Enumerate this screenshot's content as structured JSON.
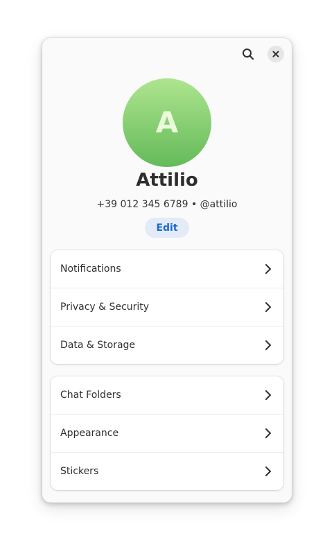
{
  "header": {
    "search_icon": "search-icon",
    "close_icon": "close-icon"
  },
  "profile": {
    "avatar_letter": "A",
    "name": "Attilio",
    "subtitle": "+39 012 345 6789 • @attilio",
    "edit_label": "Edit",
    "avatar_gradient": [
      "#aee58e",
      "#64ba5a"
    ],
    "accent": "#1c6ac8"
  },
  "groups": [
    {
      "items": [
        {
          "label": "Notifications",
          "icon": "chevron-right-icon"
        },
        {
          "label": "Privacy & Security",
          "icon": "chevron-right-icon"
        },
        {
          "label": "Data & Storage",
          "icon": "chevron-right-icon"
        }
      ]
    },
    {
      "items": [
        {
          "label": "Chat Folders",
          "icon": "chevron-right-icon"
        },
        {
          "label": "Appearance",
          "icon": "chevron-right-icon"
        },
        {
          "label": "Stickers",
          "icon": "chevron-right-icon"
        }
      ]
    }
  ]
}
